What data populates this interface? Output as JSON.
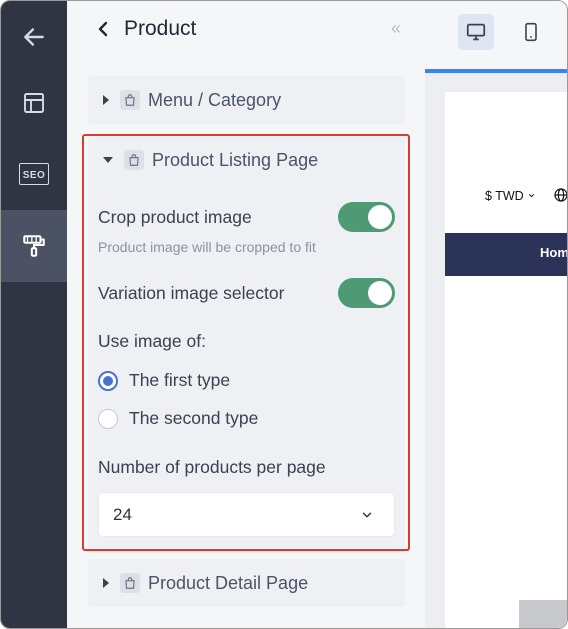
{
  "rail": {
    "items": [
      {
        "name": "back",
        "icon": "arrow-left-icon"
      },
      {
        "name": "layout",
        "icon": "layout-icon"
      },
      {
        "name": "seo",
        "icon": "seo-icon",
        "label": "SEO"
      },
      {
        "name": "theme",
        "icon": "paint-roller-icon",
        "active": true
      }
    ]
  },
  "panel": {
    "title": "Product",
    "collapse_glyph": "«"
  },
  "sections": {
    "menu_category": "Menu / Category",
    "product_listing": "Product Listing Page",
    "product_detail": "Product Detail Page"
  },
  "listing": {
    "crop_label": "Crop product image",
    "crop_enabled": true,
    "crop_hint": "Product image will be cropped to fit",
    "variation_label": "Variation image selector",
    "variation_enabled": true,
    "use_image_label": "Use image of:",
    "options": [
      {
        "label": "The first type",
        "checked": true
      },
      {
        "label": "The second type",
        "checked": false
      }
    ],
    "per_page_label": "Number of products per page",
    "per_page_value": "24"
  },
  "preview": {
    "currency": "$ TWD",
    "nav_item": "Hom",
    "active_device": "desktop"
  },
  "colors": {
    "rail": "#2f3542",
    "toggle_on": "#4e9a74",
    "radio_accent": "#4b6fd6",
    "highlight": "#d93a32",
    "preview_nav": "#2c3359",
    "preview_accent": "#3b82f6"
  }
}
